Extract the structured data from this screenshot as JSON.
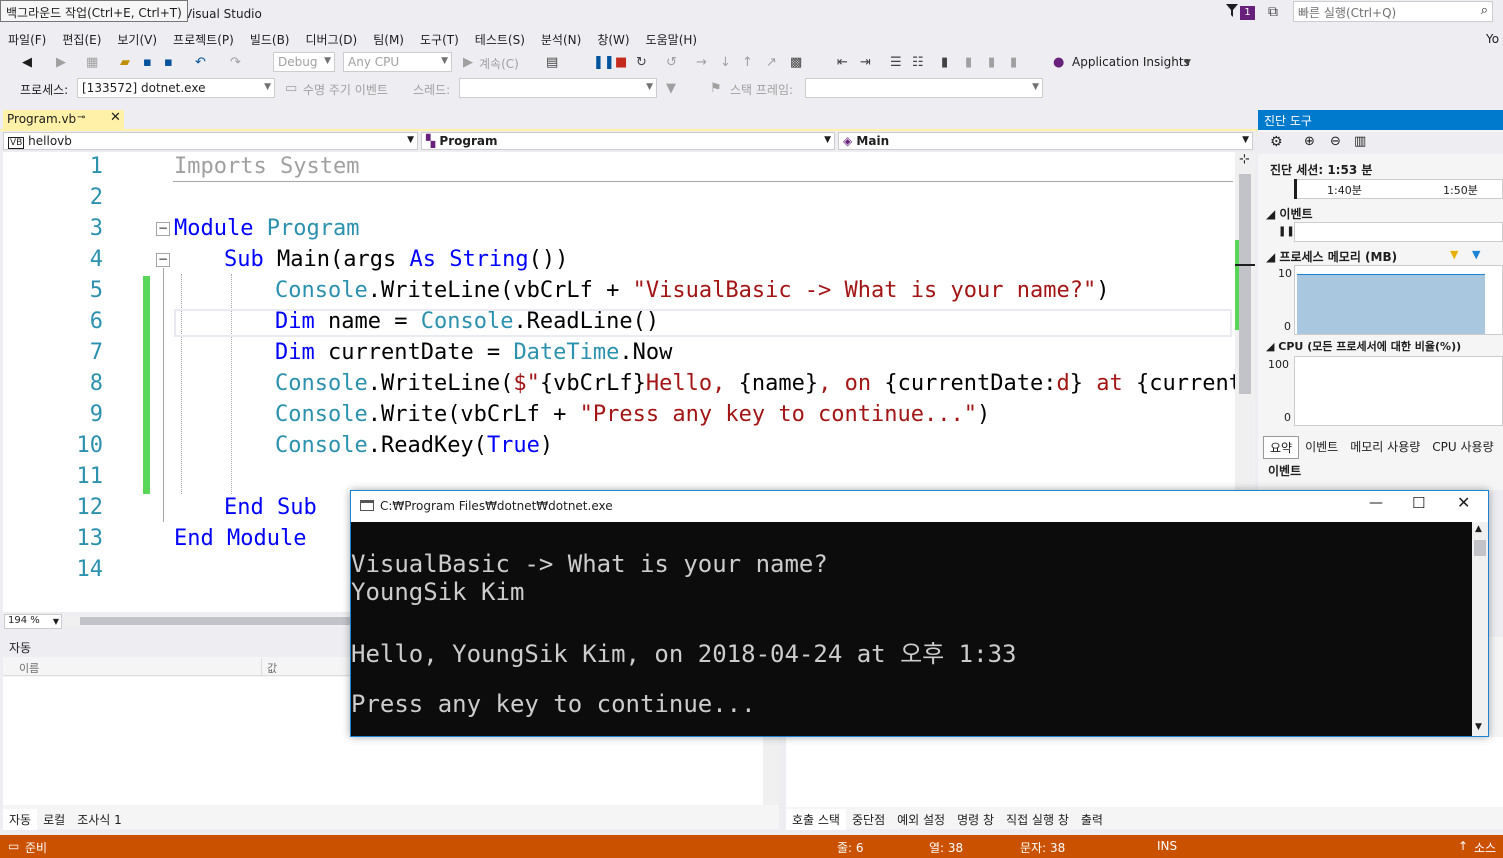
{
  "window": {
    "tooltip": "백그라운드 작업(Ctrl+E, Ctrl+T)",
    "title": "Visual Studio",
    "notification_count": "1",
    "quick_launch_placeholder": "빠른 실행(Ctrl+Q)",
    "user": "Yo"
  },
  "menu": [
    "파일(F)",
    "편집(E)",
    "보기(V)",
    "프로젝트(P)",
    "빌드(B)",
    "디버그(D)",
    "팀(M)",
    "도구(T)",
    "테스트(S)",
    "분석(N)",
    "창(W)",
    "도움말(H)"
  ],
  "toolbar": {
    "config": "Debug",
    "platform": "Any CPU",
    "continue": "계속(C)",
    "app_insights": "Application Insights"
  },
  "debug_toolbar": {
    "process_label": "프로세스:",
    "process_value": "[133572] dotnet.exe",
    "lifecycle": "수명 주기 이벤트",
    "thread_label": "스레드:",
    "stack_frame_label": "스택 프레임:"
  },
  "editor": {
    "tab_title": "Program.vb",
    "nav_project": "hellovb",
    "nav_type": "Program",
    "nav_member": "Main",
    "zoom": "194 %",
    "line_numbers": [
      "1",
      "2",
      "3",
      "4",
      "5",
      "6",
      "7",
      "8",
      "9",
      "10",
      "11",
      "12",
      "13",
      "14"
    ],
    "code": {
      "l1_a": "Imports",
      "l1_b": " System",
      "l3_a": "Module",
      "l3_b": " Program",
      "l4_a": "Sub",
      "l4_b": " Main(args ",
      "l4_c": "As",
      "l4_d": " String",
      "l4_e": "())",
      "l5_a": "Console",
      "l5_b": ".WriteLine(vbCrLf + ",
      "l5_c": "\"VisualBasic -> What is your name?\"",
      "l5_d": ")",
      "l6_a": "Dim",
      "l6_b": " name = ",
      "l6_c": "Console",
      "l6_d": ".ReadLine()",
      "l7_a": "Dim",
      "l7_b": " currentDate = ",
      "l7_c": "DateTime",
      "l7_d": ".Now",
      "l8_a": "Console",
      "l8_b": ".WriteLine(",
      "l8_c": "$\"",
      "l8_d": "{vbCrLf}",
      "l8_e": "Hello, ",
      "l8_f": "{name}",
      "l8_g": ", on ",
      "l8_h": "{currentDate:",
      "l8_i": "d",
      "l8_j": "}",
      "l8_k": " at ",
      "l8_l": "{currentDat",
      "l9_a": "Console",
      "l9_b": ".Write(vbCrLf + ",
      "l9_c": "\"Press any key to continue...\"",
      "l9_d": ")",
      "l10_a": "Console",
      "l10_b": ".ReadKey(",
      "l10_c": "True",
      "l10_d": ")",
      "l12_a": "End",
      "l12_b": " Sub",
      "l13_a": "End",
      "l13_b": " Module"
    }
  },
  "diagnostics": {
    "title": "진단 도구",
    "session": "진단 세션: 1:53 분",
    "tick1": "1:40분",
    "tick2": "1:50분",
    "events": "이벤트",
    "memory": "프로세스 메모리 (MB)",
    "mem_max": "10",
    "mem_min": "0",
    "cpu": "CPU (모든 프로세서에 대한 비율(%))",
    "cpu_max": "100",
    "cpu_min": "0",
    "tabs": [
      "요약",
      "이벤트",
      "메모리 사용량",
      "CPU 사용량"
    ],
    "events_header": "이벤트"
  },
  "autos": {
    "title": "자동",
    "col_name": "이름",
    "col_value": "값",
    "tabs": [
      "자동",
      "로컬",
      "조사식 1"
    ]
  },
  "callstack": {
    "tabs": [
      "호출 스택",
      "중단점",
      "예외 설정",
      "명령 창",
      "직접 실행 창",
      "출력"
    ]
  },
  "console": {
    "title": "C:₩Program Files₩dotnet₩dotnet.exe",
    "lines": [
      "VisualBasic -> What is your name?",
      "YoungSik Kim",
      "",
      "Hello, YoungSik Kim, on 2018-04-24 at 오후 1:33",
      "",
      "Press any key to continue..."
    ]
  },
  "status": {
    "ready": "준비",
    "line": "줄: 6",
    "col": "열: 38",
    "ch": "문자: 38",
    "ins": "INS",
    "source": "소스"
  },
  "colors": {
    "accent": "#007acc",
    "status_debug": "#ca5100",
    "tab_active": "#fff1a8",
    "keyword": "#0000ff",
    "type": "#2b91af",
    "string": "#a31515"
  }
}
